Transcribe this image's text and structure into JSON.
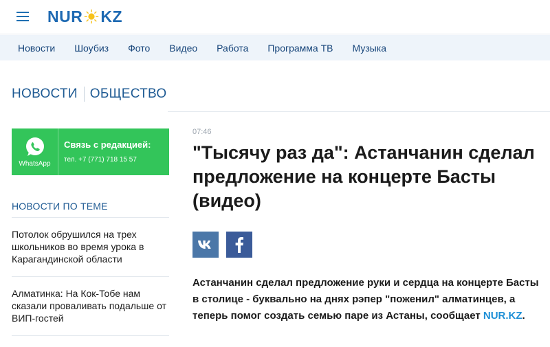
{
  "header": {
    "logo_left": "NUR",
    "logo_right": "KZ",
    "menu_icon": "hamburger-menu-icon",
    "logo_sun_icon": "sun-icon",
    "accent_color": "#1d69b2"
  },
  "nav": {
    "items": [
      "Новости",
      "Шоубиз",
      "Фото",
      "Видео",
      "Работа",
      "Программа ТВ",
      "Музыка"
    ]
  },
  "breadcrumb": {
    "section": "НОВОСТИ",
    "subsection": "ОБЩЕСТВО"
  },
  "whatsapp": {
    "label": "WhatsApp",
    "title": "Связь с редакцией:",
    "phone": "тел. +7 (771) 718 15 57",
    "icon": "whatsapp-icon",
    "color": "#33c55a"
  },
  "related": {
    "title": "НОВОСТИ ПО ТЕМЕ",
    "items": [
      "Потолок обрушился на трех школьников во время урока в Карагандинской области",
      "Алматинка: На Кок-Тобе нам сказали проваливать подальше от ВИП-гостей"
    ]
  },
  "article": {
    "time": "07:46",
    "headline_lines": [
      "\"Тысячу раз да\": Астанчанин сделал",
      "предложение на концерте Басты",
      "(видео)"
    ],
    "share": {
      "vk_icon": "vk-icon",
      "facebook_icon": "facebook-icon"
    },
    "lead_text": "Астанчанин сделал предложение руки и сердца на концерте Басты в столице - буквально на днях рэпер \"поженил\" алматинцев, а теперь помог создать семью паре из Астаны, сообщает ",
    "lead_link": "NUR.KZ",
    "lead_end": "."
  }
}
